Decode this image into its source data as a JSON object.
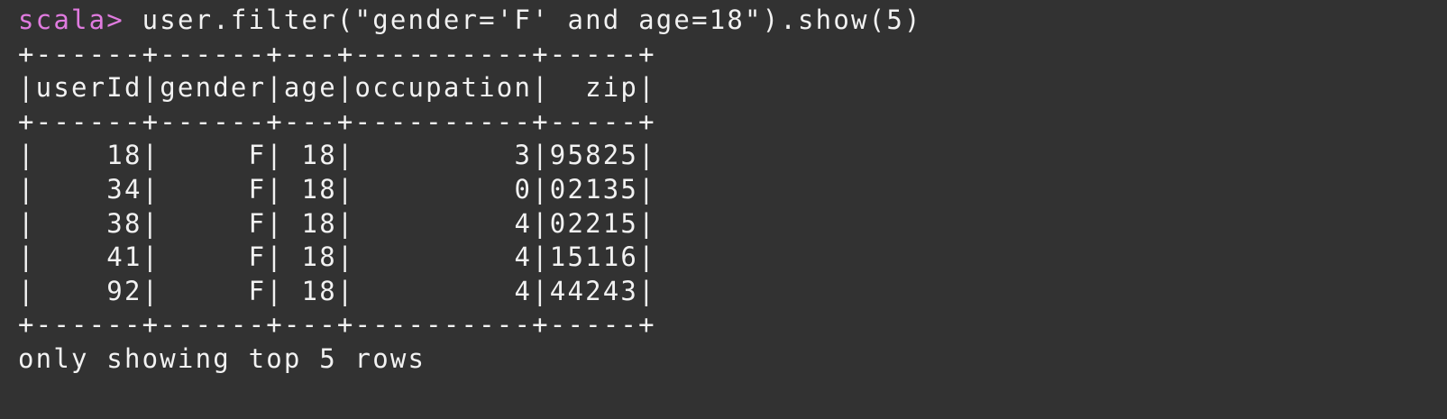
{
  "terminal": {
    "prompt": "scala> ",
    "command": "user.filter(\"gender='F' and age=18\").show(5)",
    "colors": {
      "background": "#323232",
      "text": "#f2f2f2",
      "prompt": "#e07bdf"
    },
    "output": [
      "+------+------+---+----------+-----+",
      "|userId|gender|age|occupation|  zip|",
      "+------+------+---+----------+-----+",
      "|    18|     F| 18|         3|95825|",
      "|    34|     F| 18|         0|02135|",
      "|    38|     F| 18|         4|02215|",
      "|    41|     F| 18|         4|15116|",
      "|    92|     F| 18|         4|44243|",
      "+------+------+---+----------+-----+",
      "only showing top 5 rows"
    ]
  }
}
